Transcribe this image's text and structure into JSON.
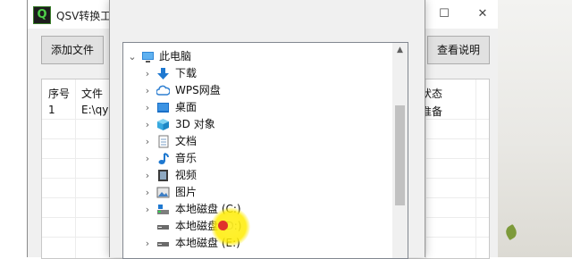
{
  "app": {
    "title": "QSV转换工具",
    "add_file_button": "添加文件",
    "help_button": "查看说明",
    "minimize_glyph": "☐",
    "close_glyph": "✕",
    "columns": {
      "index": "序号",
      "file": "文件",
      "status": "状态"
    },
    "rows": [
      {
        "index": "1",
        "file": "E:\\qy",
        "status": "准备"
      }
    ]
  },
  "folder_tree": {
    "root": {
      "label": "此电脑",
      "icon": "computer-icon"
    },
    "items": [
      {
        "label": "下载",
        "icon": "download-icon"
      },
      {
        "label": "WPS网盘",
        "icon": "cloud-icon"
      },
      {
        "label": "桌面",
        "icon": "desktop-folder-icon"
      },
      {
        "label": "3D 对象",
        "icon": "3d-objects-icon"
      },
      {
        "label": "文档",
        "icon": "documents-icon"
      },
      {
        "label": "音乐",
        "icon": "music-icon"
      },
      {
        "label": "视频",
        "icon": "video-icon"
      },
      {
        "label": "图片",
        "icon": "pictures-icon"
      },
      {
        "label": "本地磁盘 (C:)",
        "icon": "drive-c-icon"
      },
      {
        "label": "本地磁盘 (D:)",
        "icon": "drive-d-icon"
      },
      {
        "label": "本地磁盘 (E:)",
        "icon": "drive-e-icon"
      }
    ],
    "highlighted_item": "本地磁盘 (D:)"
  },
  "colors": {
    "accent": "#1e78d0",
    "highlight": "#ffe600",
    "cursor": "#e0322c"
  }
}
